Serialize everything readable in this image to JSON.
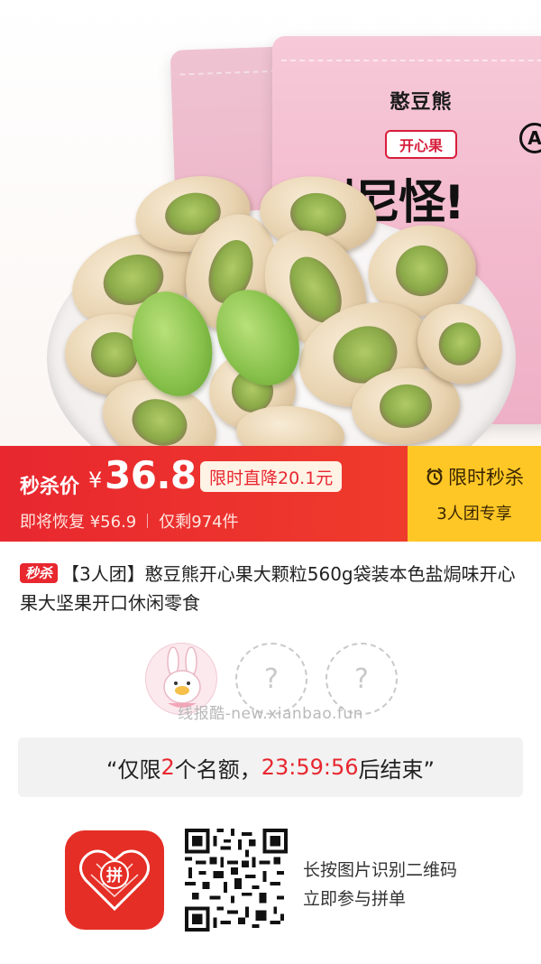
{
  "product_image": {
    "brand": "憨豆熊",
    "tag": "开心果",
    "mark": "A",
    "slogan": "别尼怪!"
  },
  "price_bar": {
    "sale_label": "秒杀价",
    "currency": "¥",
    "sale_price": "36.8",
    "drop_badge": "限时直降20.1元",
    "restore_text": "即将恢复 ¥56.9",
    "stock_text": "仅剩974件",
    "flash_label": "限时秒杀",
    "group_label": "3人团专享",
    "colors": {
      "red": "#e8272f",
      "yellow": "#ffc726"
    }
  },
  "title": {
    "badge": "秒杀",
    "text": "【3人团】憨豆熊开心果大颗粒560g袋装本色盐焗味开心果大坚果开口休闲零食"
  },
  "group": {
    "empty_slot_symbol": "?",
    "watermark": "线报酷-new.xianbao.fun"
  },
  "quota": {
    "prefix": "“仅限",
    "count": "2",
    "middle": "个名额，",
    "time": "23:59:56",
    "suffix": "后结束”"
  },
  "footer": {
    "logo_icon": "pinduoduo-logo-icon",
    "logo_text": "拼",
    "qr_line1": "长按图片识别二维码",
    "qr_line2": "立即参与拼单"
  }
}
